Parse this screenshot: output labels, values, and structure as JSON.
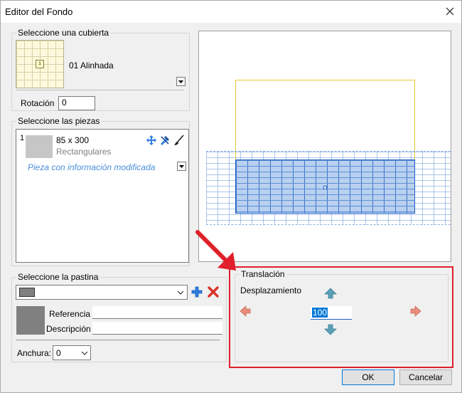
{
  "window": {
    "title": "Editor del Fondo"
  },
  "cubierta": {
    "legend": "Seleccione una cubierta",
    "name": "01 Alinhada",
    "center_marker": "1",
    "rotacion_label": "Rotación",
    "rotacion_value": "0"
  },
  "piezas": {
    "legend": "Seleccione las piezas",
    "items": [
      {
        "index": "1",
        "size": "85 x 300",
        "type": "Rectangulares",
        "note": "Pieza con información modificada"
      }
    ]
  },
  "pastina": {
    "legend": "Seleccione la pastina",
    "referencia_label": "Referencia",
    "referencia_value": "",
    "descripcion_label": "Descripción",
    "descripcion_value": "",
    "anchura_label": "Anchura:",
    "anchura_value": "0",
    "swatch_color": "#808080"
  },
  "translacion": {
    "legend": "Translación",
    "desplazamiento_label": "Desplazamiento",
    "value": "100"
  },
  "buttons": {
    "ok": "OK",
    "cancel": "Cancelar"
  },
  "colors": {
    "highlight_red": "#e0202a",
    "arrow_teal": "#5aa0b8",
    "arrow_salmon": "#e98b7a",
    "preview_outline": "#e8c930",
    "icon_blue": "#2f7de1",
    "icon_red": "#d9332a"
  }
}
